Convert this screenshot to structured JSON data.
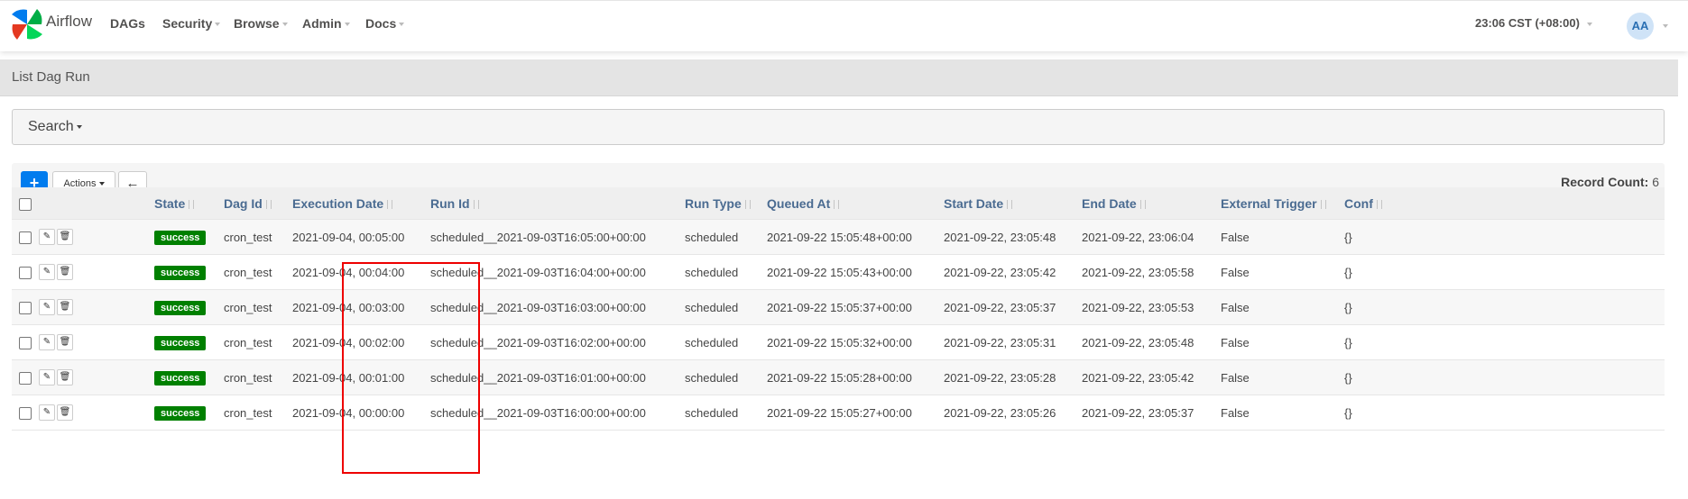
{
  "app": {
    "name": "Airflow"
  },
  "nav": {
    "dags": "DAGs",
    "security": "Security",
    "browse": "Browse",
    "admin": "Admin",
    "docs": "Docs",
    "time": "23:06 CST (+08:00)",
    "avatar": "AA"
  },
  "page": {
    "title": "List Dag Run"
  },
  "search": {
    "label": "Search"
  },
  "toolbar": {
    "add_label": "+",
    "actions_label": "Actions",
    "record_label": "Record Count:",
    "record_count": "6"
  },
  "table": {
    "columns": {
      "state": "State",
      "dag_id": "Dag Id",
      "execution_date": "Execution Date",
      "run_id": "Run Id",
      "run_type": "Run Type",
      "queued_at": "Queued At",
      "start_date": "Start Date",
      "end_date": "End Date",
      "external_trigger": "External Trigger",
      "conf": "Conf"
    },
    "rows": [
      {
        "state": "success",
        "dag_id": "cron_test",
        "execution_date": "2021-09-04, 00:05:00",
        "run_id": "scheduled__2021-09-03T16:05:00+00:00",
        "run_type": "scheduled",
        "queued_at": "2021-09-22 15:05:48+00:00",
        "start_date": "2021-09-22, 23:05:48",
        "end_date": "2021-09-22, 23:06:04",
        "external_trigger": "False",
        "conf": "{}"
      },
      {
        "state": "success",
        "dag_id": "cron_test",
        "execution_date": "2021-09-04, 00:04:00",
        "run_id": "scheduled__2021-09-03T16:04:00+00:00",
        "run_type": "scheduled",
        "queued_at": "2021-09-22 15:05:43+00:00",
        "start_date": "2021-09-22, 23:05:42",
        "end_date": "2021-09-22, 23:05:58",
        "external_trigger": "False",
        "conf": "{}"
      },
      {
        "state": "success",
        "dag_id": "cron_test",
        "execution_date": "2021-09-04, 00:03:00",
        "run_id": "scheduled__2021-09-03T16:03:00+00:00",
        "run_type": "scheduled",
        "queued_at": "2021-09-22 15:05:37+00:00",
        "start_date": "2021-09-22, 23:05:37",
        "end_date": "2021-09-22, 23:05:53",
        "external_trigger": "False",
        "conf": "{}"
      },
      {
        "state": "success",
        "dag_id": "cron_test",
        "execution_date": "2021-09-04, 00:02:00",
        "run_id": "scheduled__2021-09-03T16:02:00+00:00",
        "run_type": "scheduled",
        "queued_at": "2021-09-22 15:05:32+00:00",
        "start_date": "2021-09-22, 23:05:31",
        "end_date": "2021-09-22, 23:05:48",
        "external_trigger": "False",
        "conf": "{}"
      },
      {
        "state": "success",
        "dag_id": "cron_test",
        "execution_date": "2021-09-04, 00:01:00",
        "run_id": "scheduled__2021-09-03T16:01:00+00:00",
        "run_type": "scheduled",
        "queued_at": "2021-09-22 15:05:28+00:00",
        "start_date": "2021-09-22, 23:05:28",
        "end_date": "2021-09-22, 23:05:42",
        "external_trigger": "False",
        "conf": "{}"
      },
      {
        "state": "success",
        "dag_id": "cron_test",
        "execution_date": "2021-09-04, 00:00:00",
        "run_id": "scheduled__2021-09-03T16:00:00+00:00",
        "run_type": "scheduled",
        "queued_at": "2021-09-22 15:05:27+00:00",
        "start_date": "2021-09-22, 23:05:26",
        "end_date": "2021-09-22, 23:05:37",
        "external_trigger": "False",
        "conf": "{}"
      }
    ]
  },
  "colors": {
    "primary": "#017cee",
    "success": "#008000",
    "link": "#4a6b91",
    "highlight": "#e00000"
  }
}
